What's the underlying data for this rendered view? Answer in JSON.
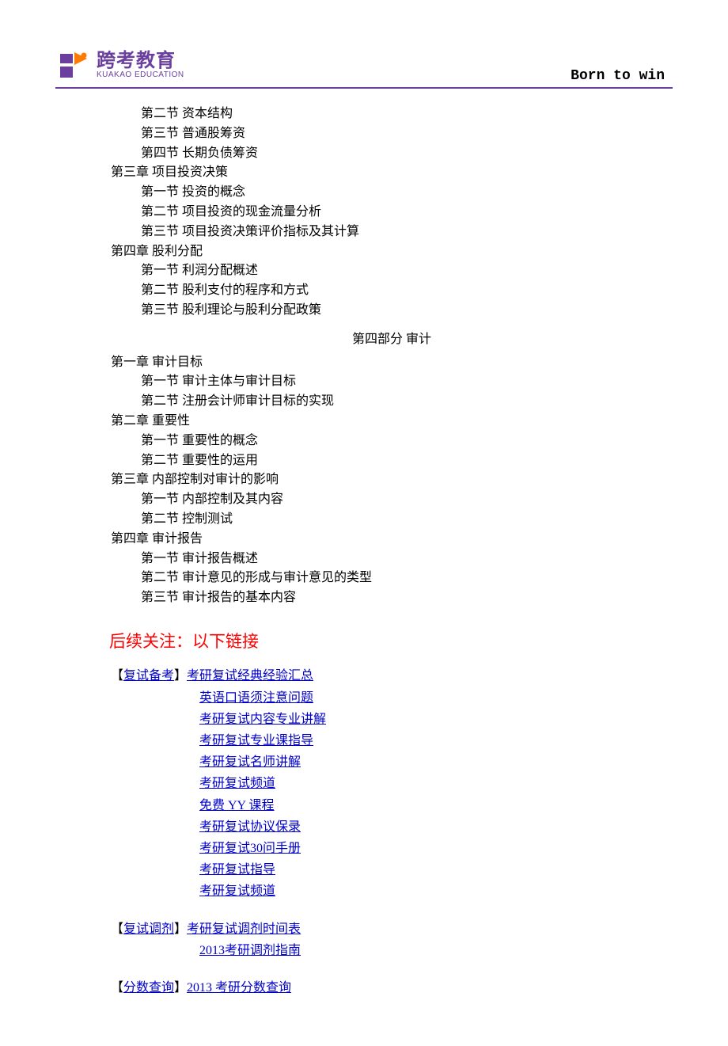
{
  "header": {
    "logo_cn": "跨考教育",
    "logo_en": "KUAKAO EDUCATION",
    "slogan": "Born to win"
  },
  "outline": [
    {
      "level": 1,
      "text": "第二节  资本结构"
    },
    {
      "level": 1,
      "text": "第三节  普通股筹资"
    },
    {
      "level": 1,
      "text": "第四节  长期负债筹资"
    },
    {
      "level": 0,
      "text": "第三章  项目投资决策"
    },
    {
      "level": 1,
      "text": "第一节  投资的概念"
    },
    {
      "level": 1,
      "text": "第二节  项目投资的现金流量分析"
    },
    {
      "level": 1,
      "text": "第三节  项目投资决策评价指标及其计算"
    },
    {
      "level": 0,
      "text": "第四章  股利分配"
    },
    {
      "level": 1,
      "text": "第一节  利润分配概述"
    },
    {
      "level": 1,
      "text": "第二节  股利支付的程序和方式"
    },
    {
      "level": 1,
      "text": "第三节  股利理论与股利分配政策"
    }
  ],
  "part4": {
    "title": "第四部分  审计",
    "outline": [
      {
        "level": 0,
        "text": "第一章  审计目标"
      },
      {
        "level": 1,
        "text": "第一节  审计主体与审计目标"
      },
      {
        "level": 1,
        "text": "第二节  注册会计师审计目标的实现"
      },
      {
        "level": 0,
        "text": "第二章  重要性"
      },
      {
        "level": 1,
        "text": "第一节  重要性的概念"
      },
      {
        "level": 1,
        "text": "第二节  重要性的运用"
      },
      {
        "level": 0,
        "text": "第三章  内部控制对审计的影响"
      },
      {
        "level": 1,
        "text": "第一节  内部控制及其内容"
      },
      {
        "level": 1,
        "text": "第二节  控制测试"
      },
      {
        "level": 0,
        "text": "第四章  审计报告"
      },
      {
        "level": 1,
        "text": "第一节  审计报告概述"
      },
      {
        "level": 1,
        "text": "第二节  审计意见的形成与审计意见的类型"
      },
      {
        "level": 1,
        "text": "第三节  审计报告的基本内容"
      }
    ]
  },
  "followup": {
    "heading": "后续关注：以下链接",
    "groups": [
      {
        "category": "复试备考",
        "links": [
          "考研复试经典经验汇总",
          "英语口语须注意问题",
          "考研复试内容专业讲解",
          "考研复试专业课指导",
          "考研复试名师讲解",
          "考研复试频道",
          "免费 YY 课程",
          "考研复试协议保录 ",
          "考研复试30问手册",
          "考研复试指导",
          "考研复试频道"
        ]
      },
      {
        "category": "复试调剂",
        "links": [
          "考研复试调剂时间表",
          "2013考研调剂指南"
        ]
      },
      {
        "category": "分数查询",
        "links": [
          "2013 考研分数查询"
        ]
      }
    ]
  }
}
